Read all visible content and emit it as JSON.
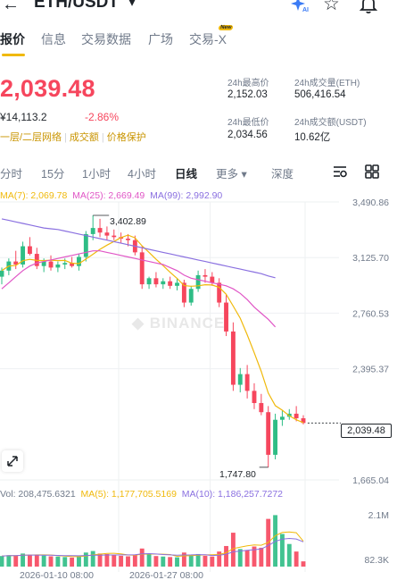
{
  "header": {
    "back_icon": "arrow-left-icon",
    "pair": "ETH/USDT",
    "caret": "▾",
    "star": "☆"
  },
  "main_nav": {
    "items": [
      "报价",
      "信息",
      "交易数据",
      "广场",
      "交易-X"
    ],
    "badge": "New"
  },
  "ticker": {
    "price": "2,039.48",
    "fiat": "¥14,113.2",
    "change": "-2.86%",
    "tags": [
      "一层/二层网络",
      "成交额",
      "价格保护"
    ]
  },
  "stats": {
    "high_label": "24h最高价",
    "high_value": "2,152.03",
    "vol_eth_label": "24h成交量(ETH)",
    "vol_eth_value": "506,416.54",
    "low_label": "24h最低价",
    "low_value": "2,034.56",
    "vol_usdt_label": "24h成交额(USDT)",
    "vol_usdt_value": "10.62亿"
  },
  "timeframes": {
    "items": [
      "分时",
      "15分",
      "1小时",
      "4小时",
      "日线",
      "更多 ▾",
      "深度"
    ],
    "active": "日线"
  },
  "indicators": {
    "ma7": "MA(7): 2,069.78",
    "ma25": "MA(25): 2,669.49",
    "ma99": "MA(99): 2,992.90",
    "vol": "Vol: 208,475.6321",
    "ma5": "MA(5): 1,177,705.5169",
    "ma10": "MA(10): 1,186,257.7272"
  },
  "colors": {
    "up": "#2ebd85",
    "down": "#f6465d",
    "ma7": "#f0b90b",
    "ma25": "#e056c6",
    "ma99": "#8a70e0",
    "accent": "#f0b90b"
  },
  "chart": {
    "price_ticks": [
      "3,490.86",
      "3,125.70",
      "2,760.53",
      "2,395.37",
      "1,665.04"
    ],
    "vol_ticks": [
      "2.1M",
      "82.3K"
    ],
    "dates": [
      "2026-01-10 08:00",
      "2026-01-27 08:00"
    ],
    "high_label": "3,402.89",
    "low_label": "1,747.80",
    "last_price": "2,039.48",
    "watermark": "BINANCE"
  },
  "chart_data": {
    "type": "candlestick",
    "ylim": [
      1665.04,
      3490.86
    ],
    "volume_ylim": [
      0,
      2100000
    ],
    "candles": [
      {
        "o": 3000,
        "h": 3060,
        "l": 2950,
        "c": 3040,
        "v": 420000
      },
      {
        "o": 3040,
        "h": 3120,
        "l": 3010,
        "c": 3100,
        "v": 450000
      },
      {
        "o": 3100,
        "h": 3170,
        "l": 3050,
        "c": 3080,
        "v": 430000
      },
      {
        "o": 3080,
        "h": 3230,
        "l": 3060,
        "c": 3200,
        "v": 520000
      },
      {
        "o": 3200,
        "h": 3260,
        "l": 3140,
        "c": 3150,
        "v": 480000
      },
      {
        "o": 3150,
        "h": 3190,
        "l": 3050,
        "c": 3070,
        "v": 460000
      },
      {
        "o": 3070,
        "h": 3120,
        "l": 3030,
        "c": 3100,
        "v": 440000
      },
      {
        "o": 3100,
        "h": 3140,
        "l": 3040,
        "c": 3060,
        "v": 410000
      },
      {
        "o": 3060,
        "h": 3100,
        "l": 3030,
        "c": 3080,
        "v": 400000
      },
      {
        "o": 3080,
        "h": 3120,
        "l": 3050,
        "c": 3090,
        "v": 380000
      },
      {
        "o": 3090,
        "h": 3130,
        "l": 3060,
        "c": 3070,
        "v": 360000
      },
      {
        "o": 3070,
        "h": 3150,
        "l": 3040,
        "c": 3130,
        "v": 420000
      },
      {
        "o": 3130,
        "h": 3300,
        "l": 3100,
        "c": 3280,
        "v": 560000
      },
      {
        "o": 3280,
        "h": 3403,
        "l": 3240,
        "c": 3320,
        "v": 620000
      },
      {
        "o": 3320,
        "h": 3380,
        "l": 3260,
        "c": 3290,
        "v": 520000
      },
      {
        "o": 3290,
        "h": 3330,
        "l": 3240,
        "c": 3270,
        "v": 500000
      },
      {
        "o": 3270,
        "h": 3310,
        "l": 3240,
        "c": 3260,
        "v": 460000
      },
      {
        "o": 3260,
        "h": 3290,
        "l": 3220,
        "c": 3250,
        "v": 430000
      },
      {
        "o": 3250,
        "h": 3280,
        "l": 3200,
        "c": 3240,
        "v": 410000
      },
      {
        "o": 3240,
        "h": 3270,
        "l": 3140,
        "c": 3160,
        "v": 460000
      },
      {
        "o": 3160,
        "h": 3200,
        "l": 2920,
        "c": 2950,
        "v": 720000
      },
      {
        "o": 2950,
        "h": 3000,
        "l": 2920,
        "c": 2990,
        "v": 480000
      },
      {
        "o": 2990,
        "h": 3030,
        "l": 2930,
        "c": 2950,
        "v": 420000
      },
      {
        "o": 2950,
        "h": 2990,
        "l": 2920,
        "c": 2970,
        "v": 400000
      },
      {
        "o": 2970,
        "h": 3000,
        "l": 2920,
        "c": 2940,
        "v": 380000
      },
      {
        "o": 2940,
        "h": 2990,
        "l": 2910,
        "c": 2960,
        "v": 370000
      },
      {
        "o": 2960,
        "h": 2980,
        "l": 2800,
        "c": 2830,
        "v": 560000
      },
      {
        "o": 2830,
        "h": 2940,
        "l": 2810,
        "c": 2920,
        "v": 470000
      },
      {
        "o": 2920,
        "h": 3040,
        "l": 2900,
        "c": 3010,
        "v": 500000
      },
      {
        "o": 3010,
        "h": 3050,
        "l": 2960,
        "c": 3000,
        "v": 430000
      },
      {
        "o": 3000,
        "h": 3030,
        "l": 2940,
        "c": 2960,
        "v": 400000
      },
      {
        "o": 2960,
        "h": 2990,
        "l": 2800,
        "c": 2830,
        "v": 600000
      },
      {
        "o": 2830,
        "h": 2880,
        "l": 2610,
        "c": 2640,
        "v": 820000
      },
      {
        "o": 2640,
        "h": 2700,
        "l": 2250,
        "c": 2290,
        "v": 1350000
      },
      {
        "o": 2290,
        "h": 2400,
        "l": 2240,
        "c": 2360,
        "v": 700000
      },
      {
        "o": 2360,
        "h": 2420,
        "l": 2200,
        "c": 2250,
        "v": 650000
      },
      {
        "o": 2250,
        "h": 2300,
        "l": 2130,
        "c": 2170,
        "v": 800000
      },
      {
        "o": 2170,
        "h": 2230,
        "l": 2090,
        "c": 2110,
        "v": 750000
      },
      {
        "o": 2110,
        "h": 2150,
        "l": 1748,
        "c": 1830,
        "v": 1900000
      },
      {
        "o": 1830,
        "h": 2100,
        "l": 1800,
        "c": 2060,
        "v": 2050000
      },
      {
        "o": 2060,
        "h": 2120,
        "l": 2020,
        "c": 2080,
        "v": 1300000
      },
      {
        "o": 2080,
        "h": 2130,
        "l": 2060,
        "c": 2100,
        "v": 900000
      },
      {
        "o": 2100,
        "h": 2150,
        "l": 2050,
        "c": 2070,
        "v": 600000
      },
      {
        "o": 2070,
        "h": 2090,
        "l": 2030,
        "c": 2039,
        "v": 208476
      }
    ],
    "ma25": [
      2920,
      2960,
      3000,
      3040,
      3070,
      3090,
      3100,
      3110,
      3120,
      3130,
      3140,
      3150,
      3160,
      3170,
      3170,
      3160,
      3150,
      3140,
      3130,
      3120,
      3110,
      3100,
      3090,
      3080,
      3060,
      3040,
      3010,
      2990,
      2980,
      2970,
      2960,
      2950,
      2940,
      2920,
      2890,
      2850,
      2800,
      2760,
      2720,
      2670
    ],
    "ma99": [
      3380,
      3370,
      3360,
      3350,
      3340,
      3330,
      3320,
      3315,
      3310,
      3300,
      3290,
      3280,
      3270,
      3260,
      3250,
      3240,
      3230,
      3220,
      3210,
      3200,
      3190,
      3180,
      3170,
      3160,
      3150,
      3140,
      3130,
      3120,
      3110,
      3100,
      3090,
      3080,
      3070,
      3060,
      3050,
      3040,
      3030,
      3020,
      3005,
      2993
    ]
  }
}
